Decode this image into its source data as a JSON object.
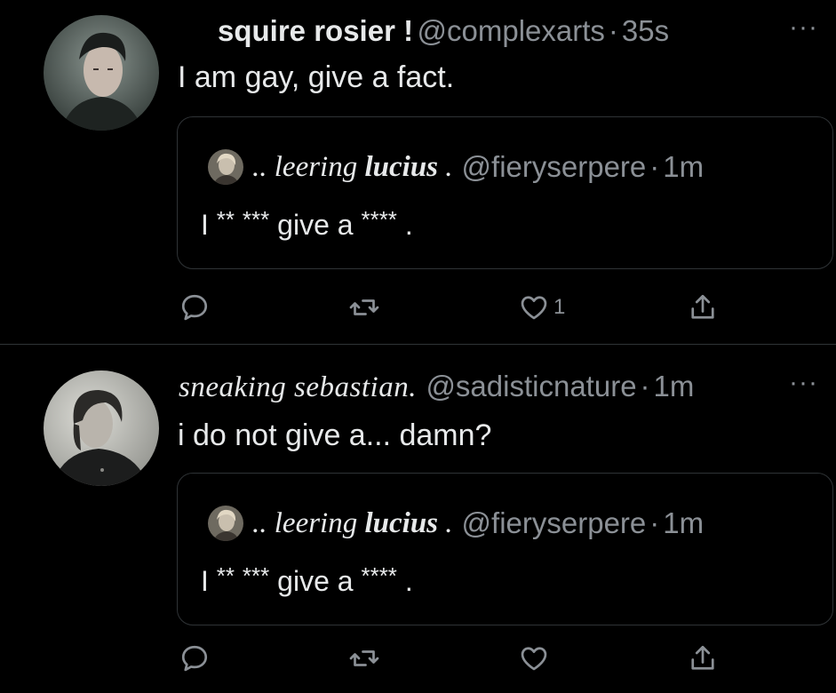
{
  "tweets": [
    {
      "display_name": "squire rosier !",
      "handle": "@complexarts",
      "separator": "·",
      "time": "35s",
      "more": "···",
      "text": "I am gay, give a fact.",
      "quote": {
        "prefix": "..",
        "name": "leering",
        "name_bold": "lucius",
        "suffix": ".",
        "handle": "@fieryserpere",
        "separator": "·",
        "time": "1m",
        "text_i": "I",
        "text_stars1": "**",
        "text_stars2": "***",
        "text_mid": "give a",
        "text_stars3": "****",
        "text_end": "."
      },
      "likes": "1"
    },
    {
      "display_name": "sneaking sebastian.",
      "handle": "@sadisticnature",
      "separator": "·",
      "time": "1m",
      "more": "···",
      "text": "i do not give a... damn?",
      "quote": {
        "prefix": "..",
        "name": "leering",
        "name_bold": "lucius",
        "suffix": ".",
        "handle": "@fieryserpere",
        "separator": "·",
        "time": "1m",
        "text_i": "I",
        "text_stars1": "**",
        "text_stars2": "***",
        "text_mid": "give a",
        "text_stars3": "****",
        "text_end": "."
      },
      "likes": ""
    }
  ],
  "icons": [
    "reply-icon",
    "retweet-icon",
    "like-icon",
    "share-icon"
  ],
  "colors": {
    "background": "#000000",
    "text": "#e7e9ea",
    "muted": "#8b9096",
    "border": "#2f3336"
  }
}
